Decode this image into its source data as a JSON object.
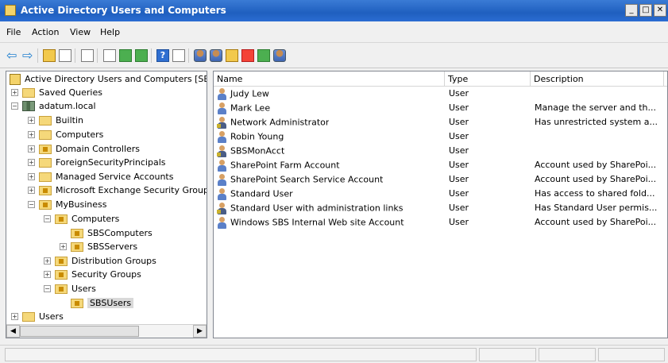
{
  "window": {
    "title": "Active Directory Users and Computers"
  },
  "menu": [
    "File",
    "Action",
    "View",
    "Help"
  ],
  "toolbar": {
    "help_label": "?"
  },
  "tree": [
    {
      "label": "Active Directory Users and Computers [SB!",
      "icon": "console-icon"
    },
    {
      "label": "Saved Queries",
      "icon": "folder-icon"
    },
    {
      "label": "adatum.local",
      "icon": "domain-icon"
    },
    {
      "label": "Builtin",
      "icon": "folder-icon"
    },
    {
      "label": "Computers",
      "icon": "folder-icon"
    },
    {
      "label": "Domain Controllers",
      "icon": "ou-icon"
    },
    {
      "label": "ForeignSecurityPrincipals",
      "icon": "folder-icon"
    },
    {
      "label": "Managed Service Accounts",
      "icon": "folder-icon"
    },
    {
      "label": "Microsoft Exchange Security Group",
      "icon": "ou-icon"
    },
    {
      "label": "MyBusiness",
      "icon": "ou-icon"
    },
    {
      "label": "Computers",
      "icon": "ou-icon"
    },
    {
      "label": "SBSComputers",
      "icon": "ou-icon"
    },
    {
      "label": "SBSServers",
      "icon": "ou-icon"
    },
    {
      "label": "Distribution Groups",
      "icon": "ou-icon"
    },
    {
      "label": "Security Groups",
      "icon": "ou-icon"
    },
    {
      "label": "Users",
      "icon": "ou-icon"
    },
    {
      "label": "SBSUsers",
      "icon": "ou-icon"
    },
    {
      "label": "Users",
      "icon": "folder-icon"
    }
  ],
  "list": {
    "columns": [
      "Name",
      "Type",
      "Description"
    ],
    "rows": [
      {
        "name": "Judy Lew",
        "type": "User",
        "description": ""
      },
      {
        "name": "Mark Lee",
        "type": "User",
        "description": "Manage the server and th..."
      },
      {
        "name": "Network Administrator",
        "type": "User",
        "description": "Has unrestricted system a..."
      },
      {
        "name": "Robin Young",
        "type": "User",
        "description": ""
      },
      {
        "name": "SBSMonAcct",
        "type": "User",
        "description": ""
      },
      {
        "name": "SharePoint Farm Account",
        "type": "User",
        "description": "Account used by SharePoi..."
      },
      {
        "name": "SharePoint Search Service Account",
        "type": "User",
        "description": "Account used by SharePoi..."
      },
      {
        "name": "Standard User",
        "type": "User",
        "description": "Has access to shared fold..."
      },
      {
        "name": "Standard User with administration links",
        "type": "User",
        "description": "Has Standard User permis..."
      },
      {
        "name": "Windows SBS Internal Web site Account",
        "type": "User",
        "description": "Account used by SharePoi..."
      }
    ]
  }
}
